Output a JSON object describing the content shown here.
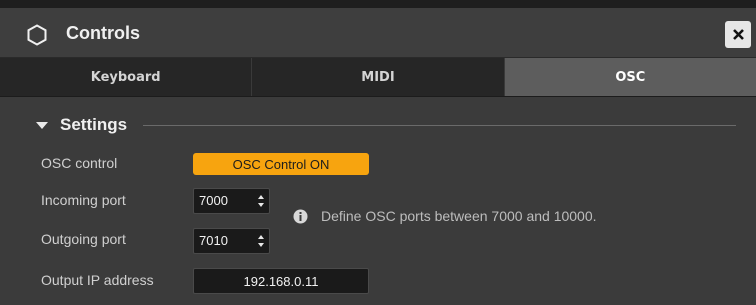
{
  "window": {
    "title": "Controls",
    "close_icon": "close-icon"
  },
  "tabs": [
    {
      "label": "Keyboard",
      "active": false
    },
    {
      "label": "MIDI",
      "active": false
    },
    {
      "label": "OSC",
      "active": true
    }
  ],
  "settings": {
    "title": "Settings",
    "expanded": true,
    "osc_control": {
      "label": "OSC control",
      "button_label": "OSC Control ON"
    },
    "incoming_port": {
      "label": "Incoming port",
      "value": "7000"
    },
    "outgoing_port": {
      "label": "Outgoing port",
      "value": "7010"
    },
    "info_text": "Define OSC ports between 7000 and 10000.",
    "output_ip": {
      "label": "Output IP address",
      "value": "192.168.0.11"
    }
  },
  "colors": {
    "accent": "#f7a40f",
    "background": "#3b3b3b",
    "active_tab": "#5d5d5d"
  }
}
